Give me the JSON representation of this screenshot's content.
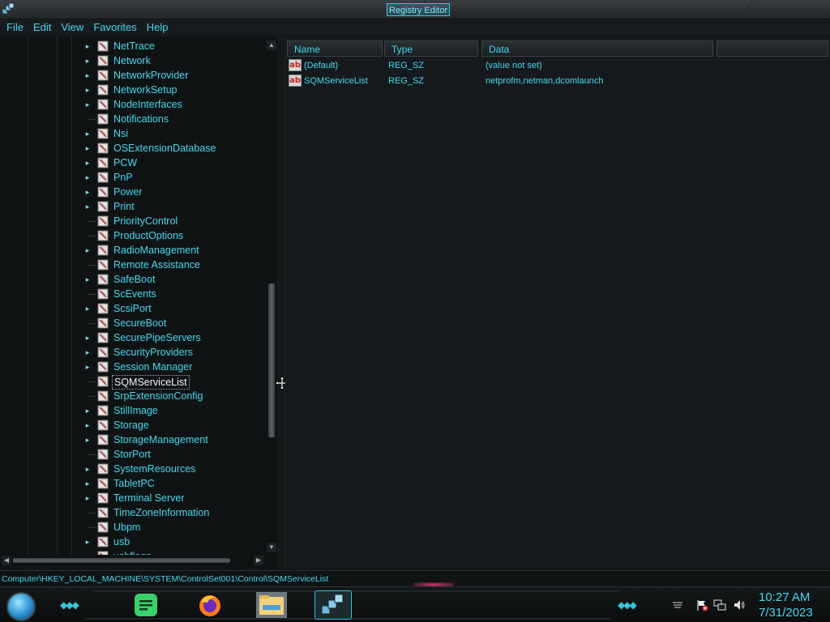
{
  "window": {
    "title": "Registry Editor"
  },
  "menu": [
    "File",
    "Edit",
    "View",
    "Favorites",
    "Help"
  ],
  "tree": {
    "items": [
      {
        "label": "NetTrace",
        "expandable": true
      },
      {
        "label": "Network",
        "expandable": true
      },
      {
        "label": "NetworkProvider",
        "expandable": true
      },
      {
        "label": "NetworkSetup",
        "expandable": true
      },
      {
        "label": "NodeInterfaces",
        "expandable": true
      },
      {
        "label": "Notifications",
        "expandable": false
      },
      {
        "label": "Nsi",
        "expandable": true
      },
      {
        "label": "OSExtensionDatabase",
        "expandable": true
      },
      {
        "label": "PCW",
        "expandable": true
      },
      {
        "label": "PnP",
        "expandable": true
      },
      {
        "label": "Power",
        "expandable": true
      },
      {
        "label": "Print",
        "expandable": true
      },
      {
        "label": "PriorityControl",
        "expandable": false
      },
      {
        "label": "ProductOptions",
        "expandable": false
      },
      {
        "label": "RadioManagement",
        "expandable": true
      },
      {
        "label": "Remote Assistance",
        "expandable": false
      },
      {
        "label": "SafeBoot",
        "expandable": true
      },
      {
        "label": "ScEvents",
        "expandable": false
      },
      {
        "label": "ScsiPort",
        "expandable": true
      },
      {
        "label": "SecureBoot",
        "expandable": false
      },
      {
        "label": "SecurePipeServers",
        "expandable": true
      },
      {
        "label": "SecurityProviders",
        "expandable": true
      },
      {
        "label": "Session Manager",
        "expandable": true
      },
      {
        "label": "SQMServiceList",
        "expandable": false,
        "selected": true
      },
      {
        "label": "SrpExtensionConfig",
        "expandable": false
      },
      {
        "label": "StillImage",
        "expandable": true
      },
      {
        "label": "Storage",
        "expandable": true
      },
      {
        "label": "StorageManagement",
        "expandable": true
      },
      {
        "label": "StorPort",
        "expandable": false
      },
      {
        "label": "SystemResources",
        "expandable": true
      },
      {
        "label": "TabletPC",
        "expandable": true
      },
      {
        "label": "Terminal Server",
        "expandable": true
      },
      {
        "label": "TimeZoneInformation",
        "expandable": false
      },
      {
        "label": "Ubpm",
        "expandable": false
      },
      {
        "label": "usb",
        "expandable": true
      },
      {
        "label": "usbflags",
        "expandable": true
      }
    ]
  },
  "list": {
    "columns": [
      "Name",
      "Type",
      "Data"
    ],
    "rows": [
      {
        "name": "(Default)",
        "type": "REG_SZ",
        "data": "(value not set)"
      },
      {
        "name": "SQMServiceList",
        "type": "REG_SZ",
        "data": "netprofm,netman,dcomlaunch"
      }
    ]
  },
  "status": {
    "path": "Computer\\HKEY_LOCAL_MACHINE\\SYSTEM\\ControlSet001\\Control\\SQMServiceList"
  },
  "taskbar": {
    "apps": [
      "notes-app-icon",
      "firefox-icon",
      "file-explorer-icon",
      "registry-editor-icon"
    ],
    "clock": {
      "time": "10:27 AM",
      "date": "7/31/2023"
    }
  },
  "colors": {
    "accent": "#46d8ee",
    "background": "#111516"
  }
}
